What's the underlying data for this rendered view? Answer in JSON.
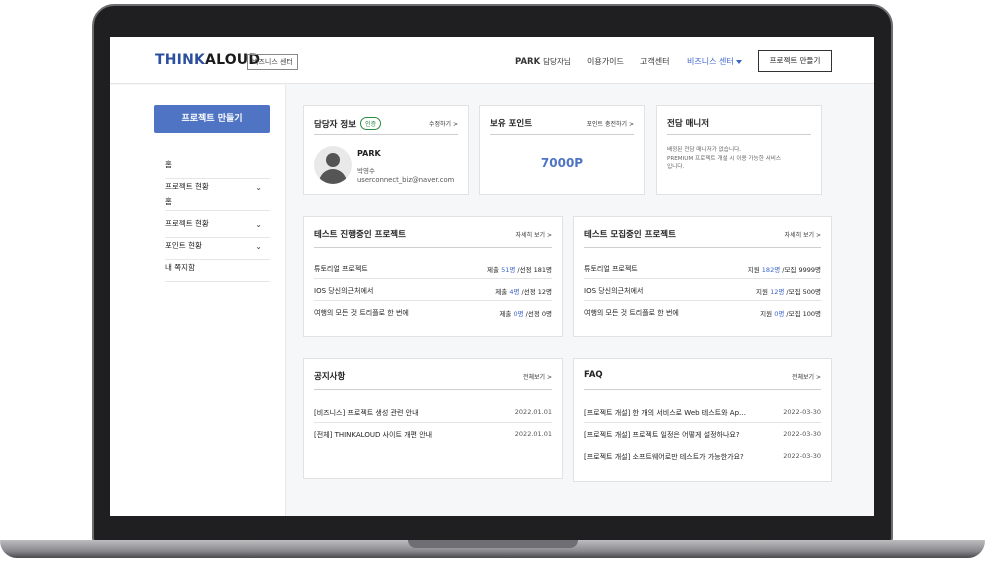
{
  "header": {
    "logo_part1": "THINK",
    "logo_part2": "ALOUD",
    "tag": "비즈니스 센터",
    "user": "PARK",
    "user_suffix": "담당자님",
    "nav": [
      "이용가이드",
      "고객센터",
      "비즈니스 센터"
    ],
    "create_button": "프로젝트 만들기"
  },
  "sidebar": {
    "create_button": "프로젝트 만들기",
    "items": [
      {
        "label": "홈"
      },
      {
        "label": "프로젝트 현황",
        "label2": "홈"
      },
      {
        "label": "프로젝트 현황"
      },
      {
        "label": "포인트 현황"
      },
      {
        "label": "내 쪽지함"
      }
    ],
    "chevron": "⌄"
  },
  "manager_card": {
    "title": "담당자 정보",
    "badge": "인증",
    "link": "수정하기 >",
    "name": "PARK",
    "nickname": "박영수",
    "email": "userconnect_biz@naver.com"
  },
  "points_card": {
    "title": "보유 포인트",
    "link": "포인트 충전하기 >",
    "value": "7000P"
  },
  "dedicated_card": {
    "title": "전담 매니저",
    "text_line1": "배정된 전담 매니저가 없습니다.",
    "text_line2": "PREMIUM 프로젝트 개설 시 이용 가능한 서비스",
    "text_line3": "입니다."
  },
  "testing_card": {
    "title": "테스트 진행중인 프로젝트",
    "link": "자세히 보기 >",
    "rows": [
      {
        "name": "튜토리얼 프로젝트",
        "pre": "제출 ",
        "num": "51명",
        "post": " /선정 181명"
      },
      {
        "name": "IOS 당신의근처에서",
        "pre": "제출 ",
        "num": "4명",
        "post": " /선정 12명"
      },
      {
        "name": "여행의 모든 것 트리플로 한 번에",
        "pre": "제출 ",
        "num": "0명",
        "post": " /선정 0명"
      }
    ]
  },
  "recruit_card": {
    "title": "테스트 모집중인 프로젝트",
    "link": "자세히 보기 >",
    "rows": [
      {
        "name": "튜토리얼 프로젝트",
        "pre": "지원 ",
        "num": "182명",
        "post": " /모집 9999명"
      },
      {
        "name": "IOS 당신의근처에서",
        "pre": "지원 ",
        "num": "12명",
        "post": " /모집 500명"
      },
      {
        "name": "여행의 모든 것 트리플로 한 번에",
        "pre": "지원 ",
        "num": "0명",
        "post": " /모집 100명"
      }
    ]
  },
  "notice_card": {
    "title": "공지사항",
    "link": "전체보기 >",
    "rows": [
      {
        "name": "[비즈니스] 프로젝트 생성 관련 안내",
        "date": "2022.01.01"
      },
      {
        "name": "[전체] THINKALOUD 사이트 개편 안내",
        "date": "2022.01.01"
      }
    ]
  },
  "faq_card": {
    "title": "FAQ",
    "link": "전체보기 >",
    "rows": [
      {
        "name": "[프로젝트 개설] 한 개의 서비스로 Web 테스트와 Ap…",
        "date": "2022-03-30"
      },
      {
        "name": "[프로젝트 개설] 프로젝트 일정은 어떻게 설정하나요?",
        "date": "2022-03-30"
      },
      {
        "name": "[프로젝트 개설] 소프트웨어로만 테스트가 가능한가요?",
        "date": "2022-03-30"
      }
    ]
  }
}
